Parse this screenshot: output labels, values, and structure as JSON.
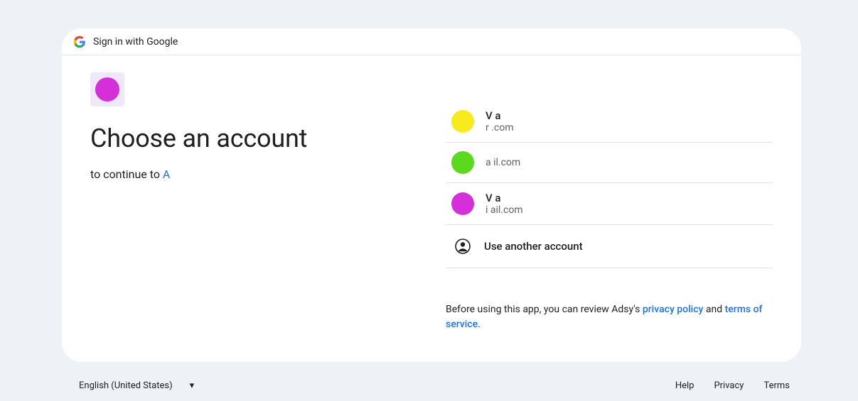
{
  "header": {
    "title": "Sign in with Google"
  },
  "app": {
    "logo_color": "#d42fd8"
  },
  "left": {
    "heading": "Choose an account",
    "continue_prefix": "to continue to ",
    "continue_app": "A"
  },
  "accounts": [
    {
      "name": "V                         a",
      "email": "r                                 .com",
      "avatar_color": "yellow"
    },
    {
      "name": "",
      "email": "a                              il.com",
      "avatar_color": "green"
    },
    {
      "name": "V                        a",
      "email": "i                               ail.com",
      "avatar_color": "magenta"
    }
  ],
  "another_label": "Use another account",
  "disclaimer": {
    "prefix": "Before using this app, you can review Adsy's ",
    "privacy": "privacy policy",
    "and": " and ",
    "terms": "terms of service",
    "suffix": "."
  },
  "footer": {
    "language": "English (United States)",
    "links": {
      "help": "Help",
      "privacy": "Privacy",
      "terms": "Terms"
    }
  }
}
